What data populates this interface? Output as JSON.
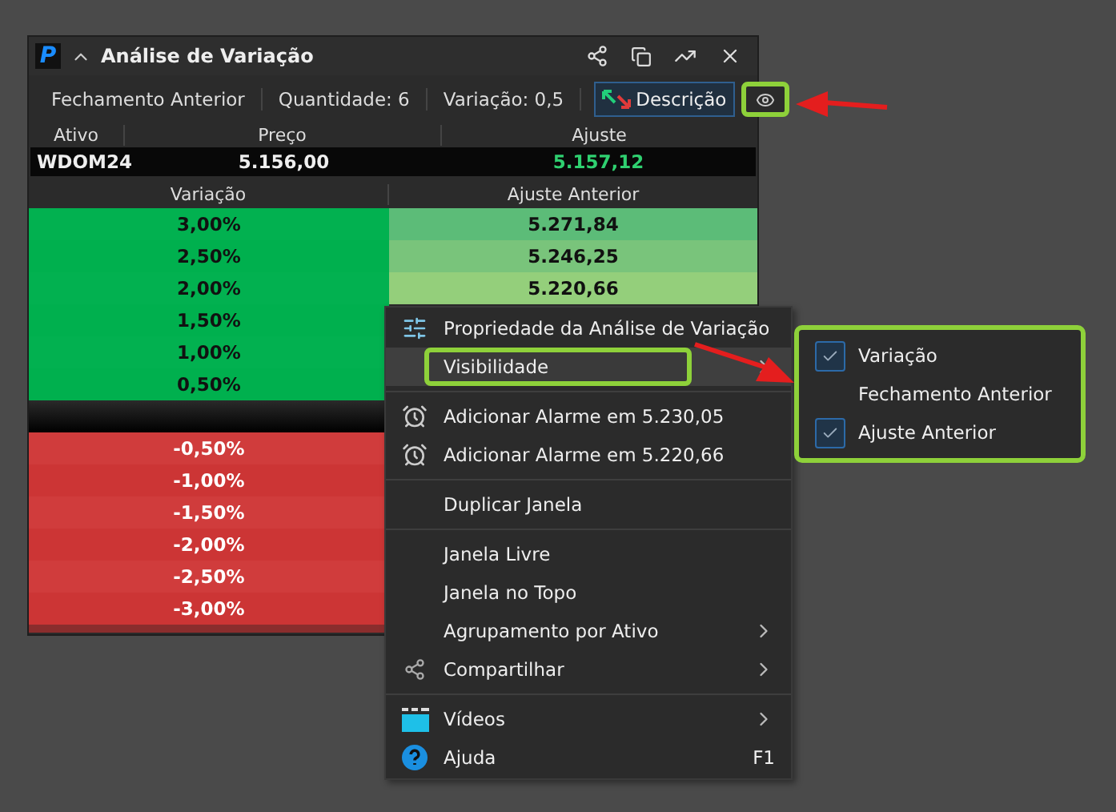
{
  "window": {
    "logo": "P",
    "title": "Análise de Variação"
  },
  "toolbar": {
    "items": [
      "Fechamento Anterior",
      "Quantidade: 6",
      "Variação: 0,5"
    ],
    "description_button": "Descrição",
    "eye_highlighted": true
  },
  "quote": {
    "columns": [
      "Ativo",
      "Preço",
      "Ajuste"
    ],
    "row": [
      "WDOM24",
      "5.156,00",
      "5.157,12"
    ]
  },
  "table": {
    "columns": [
      "Variação",
      "Ajuste Anterior"
    ],
    "rows": [
      {
        "kind": "up",
        "cells": [
          "3,00%",
          "5.271,84"
        ],
        "color": "#5cbc78"
      },
      {
        "kind": "up",
        "cells": [
          "2,50%",
          "5.246,25"
        ],
        "color": "#79c47b"
      },
      {
        "kind": "up",
        "cells": [
          "2,00%",
          "5.220,66"
        ],
        "color": "#94cf7b"
      },
      {
        "kind": "up",
        "cells": [
          "1,50%"
        ]
      },
      {
        "kind": "up",
        "cells": [
          "1,00%"
        ]
      },
      {
        "kind": "up",
        "cells": [
          "0,50%"
        ]
      },
      {
        "kind": "base",
        "cells": []
      },
      {
        "kind": "down",
        "cells": [
          "-0,50%"
        ]
      },
      {
        "kind": "down",
        "cells": [
          "-1,00%"
        ]
      },
      {
        "kind": "down",
        "cells": [
          "-1,50%"
        ]
      },
      {
        "kind": "down",
        "cells": [
          "-2,00%"
        ]
      },
      {
        "kind": "down",
        "cells": [
          "-2,50%"
        ]
      },
      {
        "kind": "down",
        "cells": [
          "-3,00%"
        ]
      }
    ]
  },
  "menu": {
    "items": [
      {
        "kind": "settings",
        "label": "Propriedade da Análise de Variação",
        "selected": false,
        "submenu": false
      },
      {
        "kind": "plain",
        "label": "Visibilidade",
        "selected": true,
        "submenu": true,
        "highlighted": true
      },
      {
        "kind": "separator"
      },
      {
        "kind": "alarm",
        "label": "Adicionar Alarme em 5.230,05",
        "selected": false,
        "submenu": false
      },
      {
        "kind": "alarm",
        "label": "Adicionar Alarme em 5.220,66",
        "selected": false,
        "submenu": false
      },
      {
        "kind": "separator"
      },
      {
        "kind": "plain",
        "label": "Duplicar Janela",
        "selected": false,
        "submenu": false
      },
      {
        "kind": "separator"
      },
      {
        "kind": "plain",
        "label": "Janela Livre",
        "selected": false,
        "submenu": false
      },
      {
        "kind": "plain",
        "label": "Janela no Topo",
        "selected": false,
        "submenu": false
      },
      {
        "kind": "plain",
        "label": "Agrupamento por Ativo",
        "selected": false,
        "submenu": true
      },
      {
        "kind": "share",
        "label": "Compartilhar",
        "selected": false,
        "submenu": true
      },
      {
        "kind": "separator"
      },
      {
        "kind": "video",
        "label": "Vídeos",
        "selected": false,
        "submenu": true
      },
      {
        "kind": "help",
        "label": "Ajuda",
        "selected": false,
        "submenu": false,
        "shortcut": "F1"
      }
    ]
  },
  "submenu": {
    "highlighted": true,
    "items": [
      {
        "label": "Variação",
        "checked": true
      },
      {
        "label": "Fechamento Anterior",
        "checked": false
      },
      {
        "label": "Ajuste Anterior",
        "checked": true
      }
    ]
  }
}
